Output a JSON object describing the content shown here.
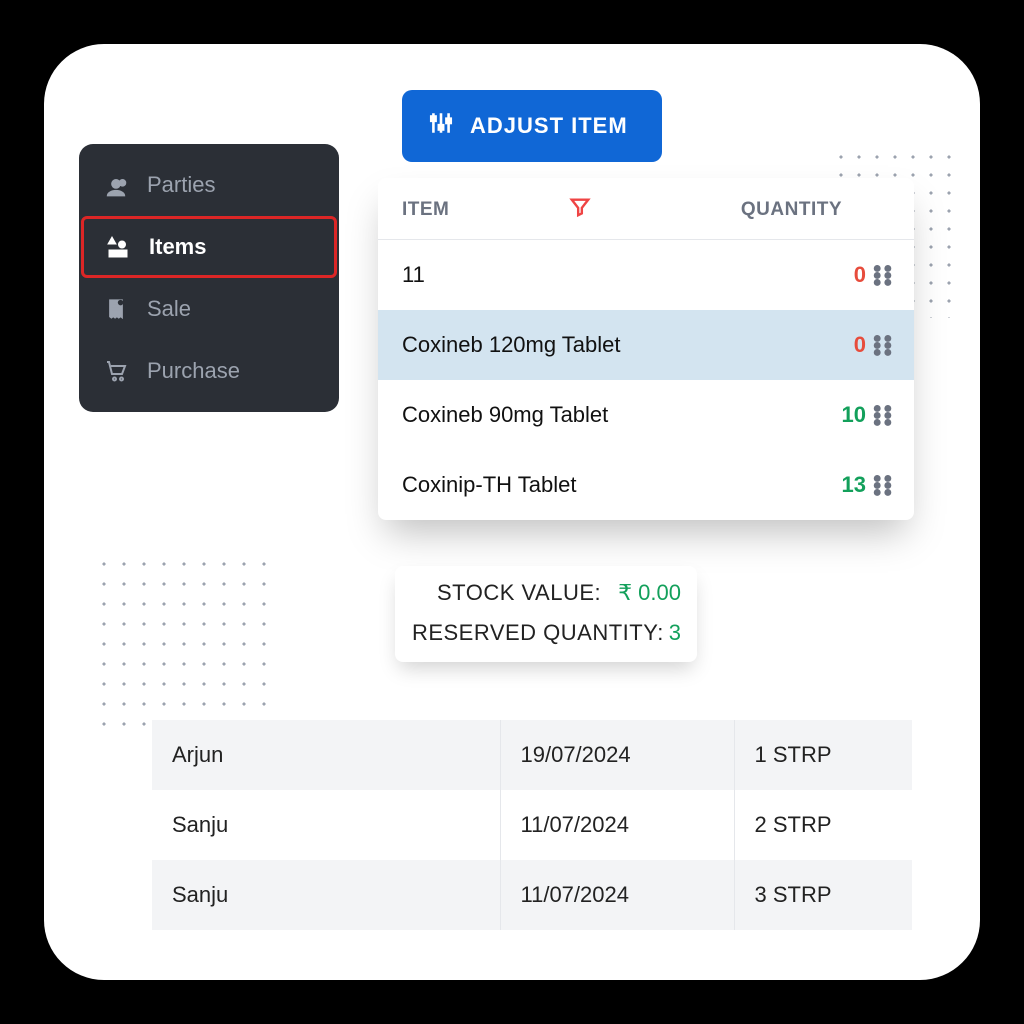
{
  "sidebar": {
    "items": [
      {
        "label": "Parties",
        "icon": "users"
      },
      {
        "label": "Items",
        "icon": "shapes",
        "active": true
      },
      {
        "label": "Sale",
        "icon": "receipt"
      },
      {
        "label": "Purchase",
        "icon": "cart"
      }
    ]
  },
  "adjust_button": {
    "label": "ADJUST ITEM"
  },
  "items_table": {
    "header": {
      "item": "ITEM",
      "quantity": "QUANTITY"
    },
    "rows": [
      {
        "name": "11",
        "qty": "0",
        "qty_class": "zero"
      },
      {
        "name": "Coxineb 120mg Tablet",
        "qty": "0",
        "qty_class": "zero",
        "selected": true
      },
      {
        "name": "Coxineb 90mg Tablet",
        "qty": "10",
        "qty_class": "pos"
      },
      {
        "name": "Coxinip-TH Tablet",
        "qty": "13",
        "qty_class": "pos"
      }
    ]
  },
  "stock_card": {
    "stock_value_label": "STOCK VALUE:",
    "stock_value": "₹ 0.00",
    "reserved_label": "RESERVED QUANTITY:",
    "reserved_qty": "3"
  },
  "reservations": [
    {
      "name": "Arjun",
      "date": "19/07/2024",
      "qty": "1 STRP"
    },
    {
      "name": "Sanju",
      "date": "11/07/2024",
      "qty": "2 STRP"
    },
    {
      "name": "Sanju",
      "date": "11/07/2024",
      "qty": "3 STRP"
    }
  ]
}
